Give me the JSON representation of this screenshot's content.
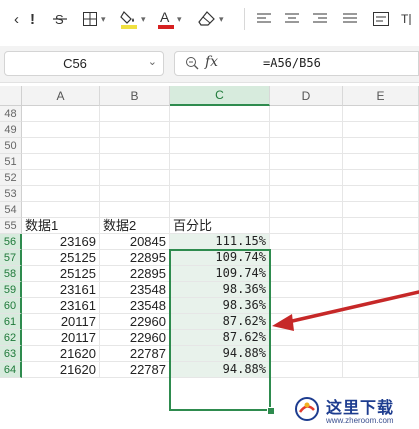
{
  "toolbar": {
    "items": [
      {
        "name": "back-chevron-icon",
        "glyph": "‹"
      },
      {
        "name": "clear-format-icon",
        "glyph": "!"
      },
      {
        "name": "strikethrough-icon",
        "glyph": "S̶"
      },
      {
        "name": "borders-icon",
        "glyph": "▦"
      },
      {
        "name": "fill-color-icon",
        "glyph": "◈"
      },
      {
        "name": "font-color-icon",
        "glyph": "A"
      },
      {
        "name": "eraser-icon",
        "glyph": "◇"
      },
      {
        "name": "align-left-icon",
        "glyph": "☰"
      },
      {
        "name": "align-center-icon",
        "glyph": "☰"
      },
      {
        "name": "align-right-icon",
        "glyph": "☰"
      },
      {
        "name": "wrap-text-icon",
        "glyph": "⊞"
      }
    ],
    "colors": {
      "fill": "#f0e040",
      "font": "#d62020"
    }
  },
  "formula_bar": {
    "name_box": "C56",
    "fx_label": "fx",
    "formula": "=A56/B56"
  },
  "columns": [
    "A",
    "B",
    "C",
    "D",
    "E"
  ],
  "rows": [
    "48",
    "49",
    "50",
    "51",
    "52",
    "53",
    "54",
    "55",
    "56",
    "57",
    "58",
    "59",
    "60",
    "61",
    "62",
    "63",
    "64"
  ],
  "headers": {
    "a": "数据1",
    "b": "数据2",
    "c": "百分比"
  },
  "data": [
    {
      "a": "23169",
      "b": "20845",
      "c": "111.15%"
    },
    {
      "a": "25125",
      "b": "22895",
      "c": "109.74%"
    },
    {
      "a": "25125",
      "b": "22895",
      "c": "109.74%"
    },
    {
      "a": "23161",
      "b": "23548",
      "c": "98.36%"
    },
    {
      "a": "23161",
      "b": "23548",
      "c": "98.36%"
    },
    {
      "a": "20117",
      "b": "22960",
      "c": "87.62%"
    },
    {
      "a": "20117",
      "b": "22960",
      "c": "87.62%"
    },
    {
      "a": "21620",
      "b": "22787",
      "c": "94.88%"
    },
    {
      "a": "21620",
      "b": "22787",
      "c": "94.88%"
    }
  ],
  "watermark": {
    "title": "这里下载",
    "url": "www.zheroom.com"
  },
  "accent": "#2e8b4e",
  "arrow_color": "#c62828"
}
